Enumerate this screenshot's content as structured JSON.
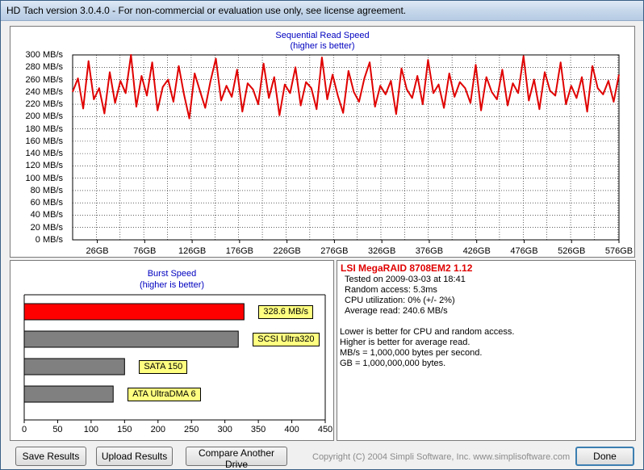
{
  "window": {
    "title": "HD Tach version 3.0.4.0  - For non-commercial or evaluation use only, see license agreement."
  },
  "colors": {
    "read_line": "#e00000",
    "burst_bar": "#ff0000",
    "ref_bar": "#808080",
    "title_blue": "#0000c0",
    "label_bg": "#ffff80"
  },
  "read_chart": {
    "title": "Sequential Read Speed",
    "subtitle": "(higher is better)",
    "y_ticks": [
      "300 MB/s",
      "280 MB/s",
      "260 MB/s",
      "240 MB/s",
      "220 MB/s",
      "200 MB/s",
      "180 MB/s",
      "160 MB/s",
      "140 MB/s",
      "120 MB/s",
      "100 MB/s",
      "80 MB/s",
      "60 MB/s",
      "40 MB/s",
      "20 MB/s",
      "0 MB/s"
    ],
    "x_ticks": [
      "26GB",
      "76GB",
      "126GB",
      "176GB",
      "226GB",
      "276GB",
      "326GB",
      "376GB",
      "426GB",
      "476GB",
      "526GB",
      "576GB"
    ]
  },
  "burst_chart": {
    "title": "Burst Speed",
    "subtitle": "(higher is better)",
    "x_ticks": [
      "0",
      "50",
      "100",
      "150",
      "200",
      "250",
      "300",
      "350",
      "400",
      "450"
    ]
  },
  "chart_data": [
    {
      "type": "line",
      "title": "Sequential Read Speed",
      "subtitle": "(higher is better)",
      "xlabel": "",
      "ylabel": "",
      "xlim": [
        0,
        576
      ],
      "ylim": [
        0,
        300
      ],
      "grid": true,
      "series": [
        {
          "values": [
            240,
            262,
            213,
            290,
            228,
            246,
            205,
            272,
            222,
            258,
            238,
            300,
            216,
            266,
            234,
            288,
            210,
            248,
            260,
            224,
            282,
            236,
            197,
            270,
            242,
            214,
            258,
            294,
            226,
            250,
            232,
            276,
            208,
            254,
            244,
            220,
            286,
            230,
            264,
            202,
            252,
            238,
            280,
            218,
            256,
            246,
            212,
            296,
            228,
            268,
            234,
            206,
            274,
            240,
            224,
            262,
            288,
            216,
            250,
            236,
            258,
            204,
            278,
            244,
            230,
            266,
            220,
            292,
            238,
            252,
            214,
            270,
            232,
            256,
            246,
            222,
            284,
            210,
            264,
            240,
            228,
            276,
            218,
            254,
            238,
            298,
            226,
            260,
            212,
            272,
            242,
            234,
            288,
            220,
            250,
            230,
            264,
            208,
            282,
            246,
            236,
            258,
            224,
            268
          ]
        }
      ]
    },
    {
      "type": "bar",
      "title": "Burst Speed",
      "subtitle": "(higher is better)",
      "xlabel": "",
      "ylabel": "",
      "xlim": [
        0,
        450
      ],
      "categories": [
        "328.6 MB/s",
        "SCSI Ultra320",
        "SATA 150",
        "ATA UltraDMA 6"
      ],
      "values": [
        328.6,
        320,
        150,
        133
      ]
    }
  ],
  "burst_labels": [
    "328.6 MB/s",
    "SCSI Ultra320",
    "SATA 150",
    "ATA UltraDMA 6"
  ],
  "info": {
    "title": "LSI MegaRAID 8708EM2 1.12",
    "tested": "Tested on 2009-03-03 at 18:41",
    "random_access": "Random access: 5.3ms",
    "cpu": "CPU utilization: 0% (+/- 2%)",
    "avg_read": "Average read: 240.6 MB/s",
    "note1": "Lower is better for CPU and random access.",
    "note2": "Higher is better for average read.",
    "note3": "MB/s = 1,000,000 bytes per second.",
    "note4": "GB = 1,000,000,000 bytes."
  },
  "buttons": {
    "save": "Save Results",
    "upload": "Upload Results",
    "compare": "Compare Another Drive",
    "done": "Done"
  },
  "copyright": "Copyright (C) 2004 Simpli Software, Inc. www.simplisoftware.com"
}
